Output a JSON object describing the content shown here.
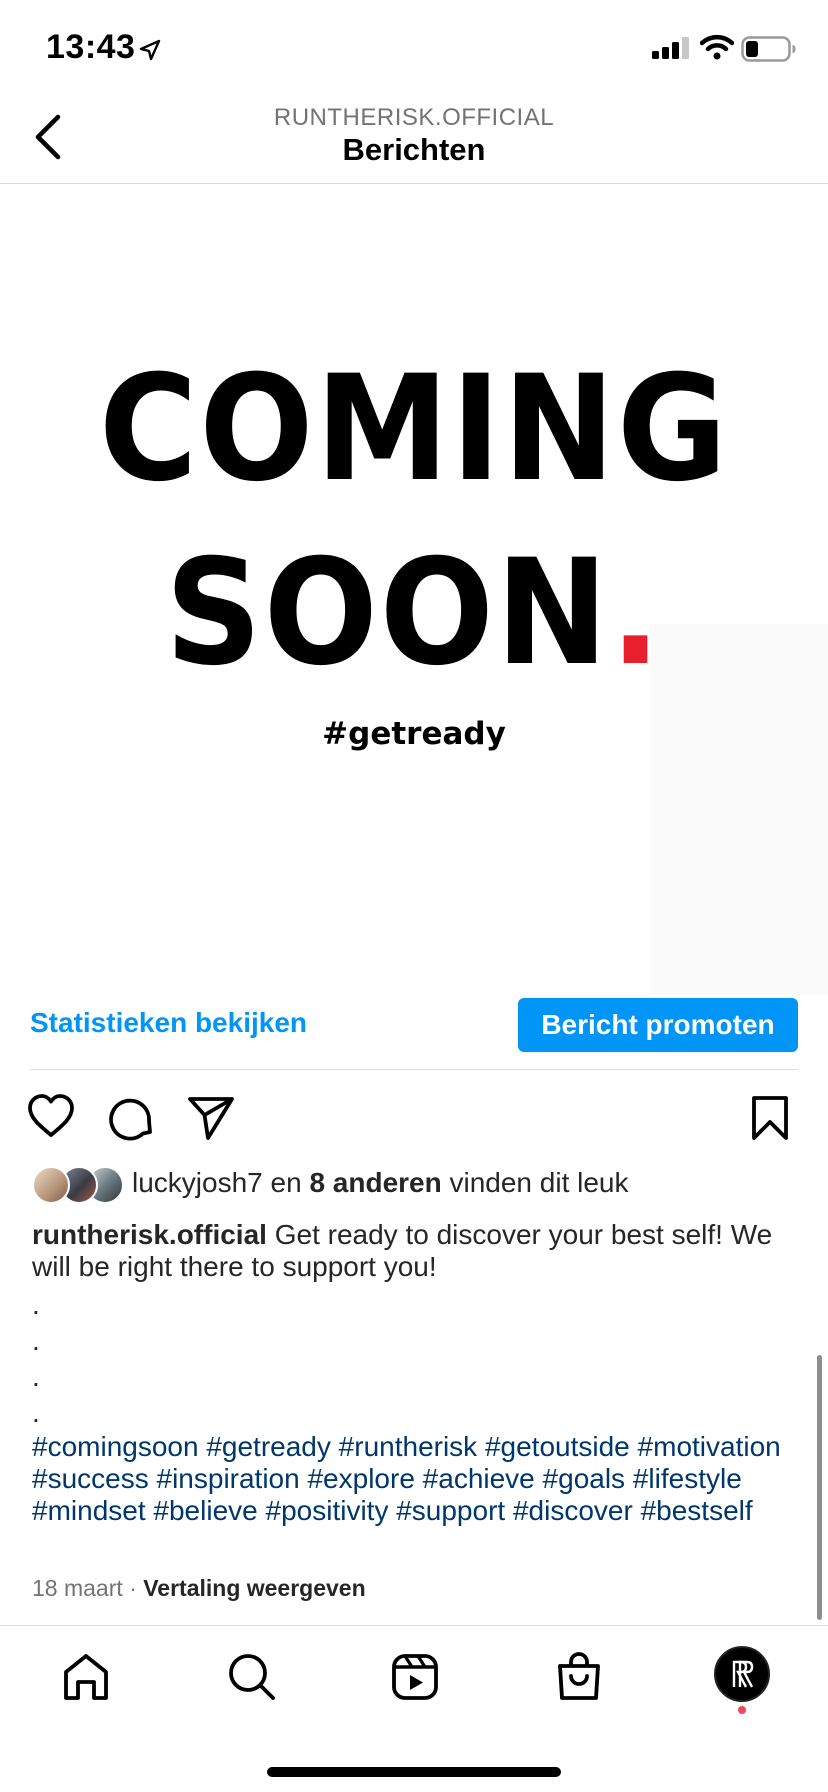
{
  "status_bar": {
    "time": "13:43"
  },
  "header": {
    "account": "RUNTHERISK.OFFICIAL",
    "title": "Berichten"
  },
  "post_image": {
    "line1": "COMING",
    "line2": "SOON",
    "dot": ".",
    "hashtag": "#getready",
    "accent_color": "#e8202e"
  },
  "actions": {
    "insights_label": "Statistieken bekijken",
    "promote_label": "Bericht promoten"
  },
  "likes": {
    "user": "luckyjosh7",
    "connector": " en ",
    "others": "8 anderen",
    "suffix": " vinden dit leuk"
  },
  "caption": {
    "username": "runtherisk.official",
    "text": "Get ready to discover your best self! We will be right there to support you!",
    "dots": [
      ".",
      ".",
      ".",
      "."
    ],
    "hashtags": [
      "#comingsoon",
      "#getready",
      "#runtherisk",
      "#getoutside",
      "#motivation",
      "#success",
      "#inspiration",
      "#explore",
      "#achieve",
      "#goals",
      "#lifestyle",
      "#mindset",
      "#believe",
      "#positivity",
      "#support",
      "#discover",
      "#bestself"
    ]
  },
  "meta": {
    "date": "18 maart",
    "separator": "·",
    "translate_label": "Vertaling weergeven"
  },
  "colors": {
    "link_blue": "#0095f6",
    "hashtag_blue": "#00376b",
    "notification_dot": "#ed4956"
  }
}
